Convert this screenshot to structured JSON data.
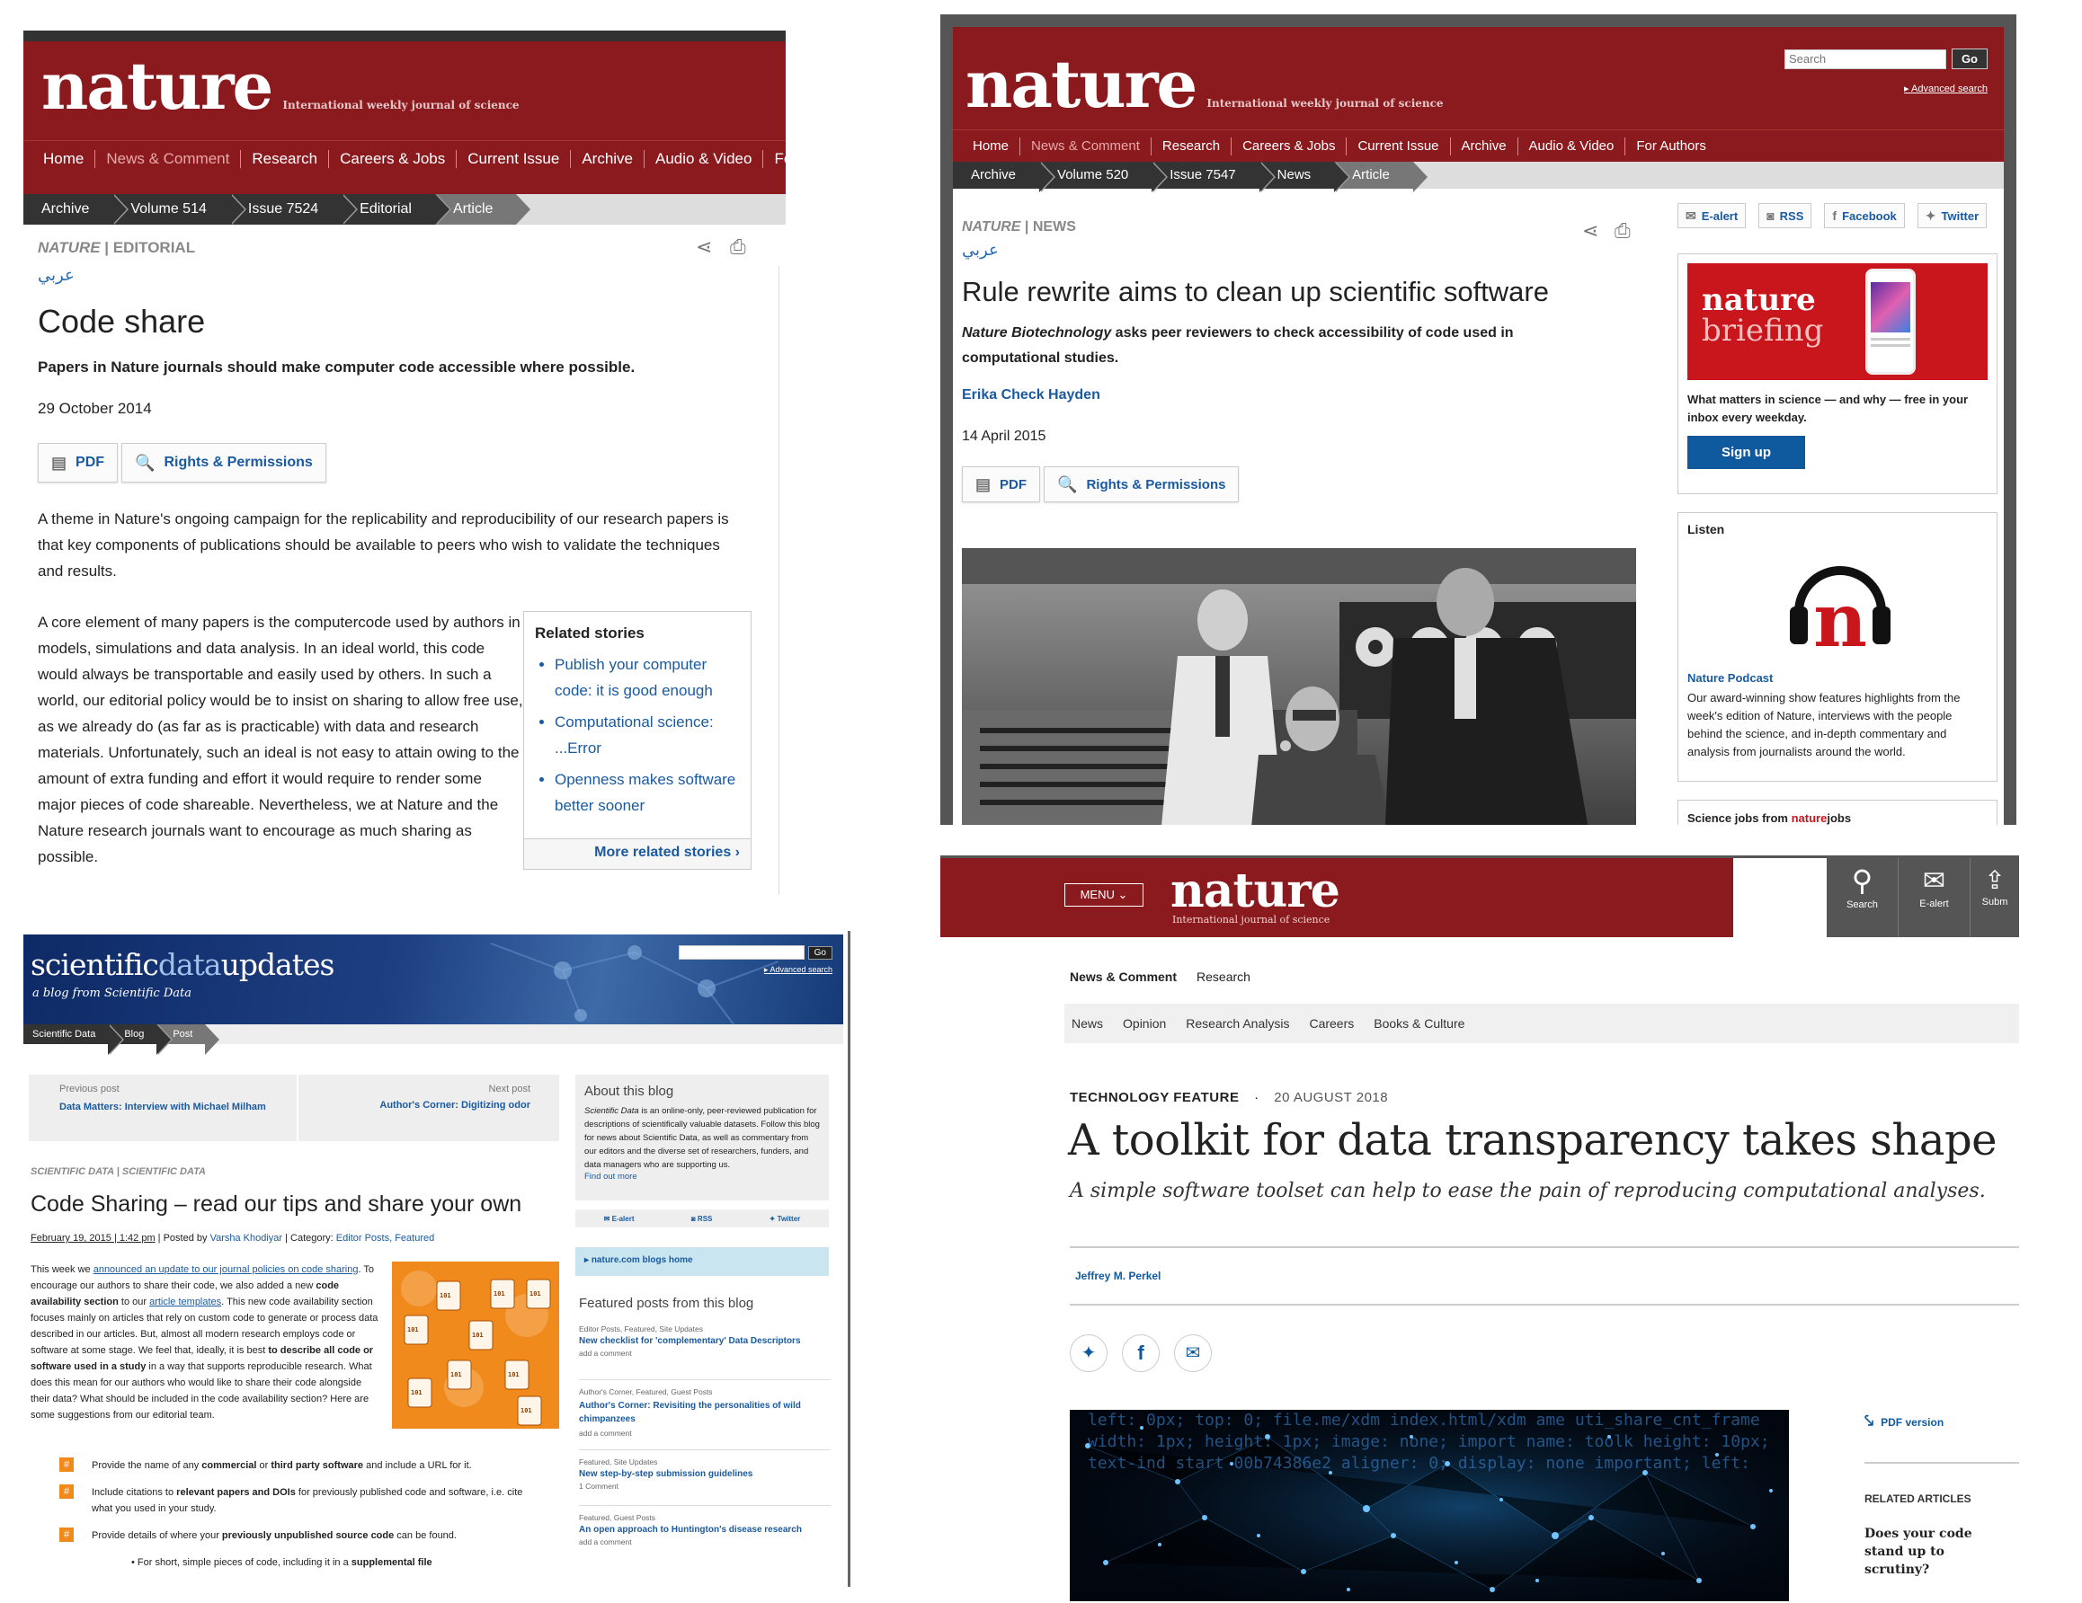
{
  "p1": {
    "logo": "nature",
    "tagline": "International weekly journal of science",
    "nav": [
      "Home",
      "News & Comment",
      "Research",
      "Careers & Jobs",
      "Current Issue",
      "Archive",
      "Audio & Video",
      "For Auth"
    ],
    "crumbs": [
      "Archive",
      "Volume 514",
      "Issue 7524",
      "Editorial",
      "Article"
    ],
    "kicker_a": "NATURE",
    "kicker_sep": " | ",
    "kicker_b": "EDITORIAL",
    "arabic": "عربي",
    "title": "Code share",
    "standfirst": "Papers in Nature journals should make computer code accessible where possible.",
    "date": "29 October 2014",
    "pdf": "PDF",
    "rights": "Rights & Permissions",
    "para1": "A theme in Nature's ongoing campaign for the replicability and reproducibility of our research papers is that key components of publications should be available to peers who wish to validate the techniques and results.",
    "para2": "A core element of many papers is the computercode used by authors in models, simulations and data analysis. In an ideal world, this code would always be transportable and easily used by others. In such a world, our editorial policy would be to insist on sharing to allow free use, as we already do (as far as is practicable) with data and research materials. Unfortunately, such an ideal is not easy to attain owing to the amount of extra funding and effort it would require to render some major pieces of code shareable. Nevertheless, we at Nature and the Nature research journals want to encourage as much sharing as possible.",
    "related_title": "Related stories",
    "related": [
      "Publish your computer code: it is good enough",
      "Computational science: ...Error",
      "Openness makes software better sooner"
    ],
    "more_related": "More related stories"
  },
  "p2": {
    "logo": "nature",
    "tagline": "International weekly journal of science",
    "search_placeholder": "Search",
    "go": "Go",
    "advanced": "Advanced search",
    "nav": [
      "Home",
      "News & Comment",
      "Research",
      "Careers & Jobs",
      "Current Issue",
      "Archive",
      "Audio & Video",
      "For Authors"
    ],
    "crumbs": [
      "Archive",
      "Volume 520",
      "Issue 7547",
      "News",
      "Article"
    ],
    "kicker_a": "NATURE",
    "kicker_sep": " | ",
    "kicker_b": "NEWS",
    "arabic": "عربي",
    "title": "Rule rewrite aims to clean up scientific software",
    "standfirst_i": "Nature Biotechnology",
    "standfirst": " asks peer reviewers to check accessibility of code used in computational studies.",
    "author": "Erika Check Hayden",
    "date": "14 April 2015",
    "pdf": "PDF",
    "rights": "Rights & Permissions",
    "social": [
      "E-alert",
      "RSS",
      "Facebook",
      "Twitter"
    ],
    "briefing_logo1": "nature",
    "briefing_logo2": "briefing",
    "briefing_text": "What matters in science — and why — free in your inbox every weekday.",
    "signup": "Sign up",
    "listen": "Listen",
    "podcast_title": "Nature Podcast",
    "podcast_text": "Our award-winning show features highlights from the week's edition of Nature, interviews with the people behind the science, and in-depth commentary and analysis from journalists around the world.",
    "jobs_a": "Science jobs from ",
    "jobs_b": "nature",
    "jobs_c": "jobs"
  },
  "p3": {
    "logo_a": "scientific",
    "logo_b": "data",
    "logo_c": "updates",
    "sub": "a blog from Scientific Data",
    "go": "Go",
    "advanced": "Advanced search",
    "crumbs": [
      "Scientific Data",
      "Blog",
      "Post"
    ],
    "prev_label": "Previous post",
    "prev_link": "Data Matters: Interview with Michael Milham",
    "next_label": "Next post",
    "next_link": "Author's Corner: Digitizing odor",
    "kicker": "SCIENTIFIC DATA | SCIENTIFIC DATA",
    "title": "Code Sharing – read our tips and share your own",
    "meta_date": "February 19, 2015 | 1:42 pm",
    "meta_rest": " | Posted by ",
    "author": "Varsha Khodiyar",
    "meta_cat": " | Category: ",
    "cats": "Editor Posts, Featured",
    "p1a": "This week we ",
    "p1link": "announced an update to our journal policies on code sharing",
    "p1b": ". To encourage our authors to share their code, we also added a new ",
    "p1bold": "code availability section",
    "p1c": " to our ",
    "p1link2": "article templates",
    "p1d": ". This new code availability section focuses mainly on articles that rely on custom code to generate or process data described in our articles. But, almost all modern research employs code or software at some stage. We feel that, ideally, it is best ",
    "p1bold2": "to describe all code or software used in a study",
    "p1e": " in a way that supports reproducible research. What does this mean for our authors who would like to share their code alongside their data? What should be included in the code availability section? Here are some suggestions from our editorial team.",
    "bullets": [
      {
        "a": "Provide the name of any ",
        "b": "commercial",
        "c": " or ",
        "d": "third party software",
        "e": " and include a URL for it."
      },
      {
        "a": "Include citations to ",
        "b": "relevant papers and DOIs",
        "c": " for previously published code and software, i.e. cite what you used in your study.",
        "d": "",
        "e": ""
      },
      {
        "a": "Provide details of where your ",
        "b": "previously unpublished source code",
        "c": " can be found.",
        "d": "",
        "e": ""
      }
    ],
    "sub_bullet_a": "For short, simple pieces of code, including it in a ",
    "sub_bullet_b": "supplemental file",
    "about_title": "About this blog",
    "about_text_i": "Scientific Data",
    "about_text": " is an online-only, peer-reviewed publication for descriptions of scientifically valuable datasets. Follow this blog for news about Scientific Data, as well as commentary from our editors and the diverse set of researchers, funders, and data managers who are supporting us.",
    "find_more": "Find out more",
    "social": [
      "E-alert",
      "RSS",
      "Twitter"
    ],
    "blogs_home": "nature.com blogs home",
    "featured_title": "Featured posts from this blog",
    "featured": [
      {
        "cat": "Editor Posts, Featured, Site Updates",
        "title": "New checklist for 'complementary' Data Descriptors",
        "c": "add a comment"
      },
      {
        "cat": "Author's Corner, Featured, Guest Posts",
        "title": "Author's Corner: Revisiting the personalities of wild chimpanzees",
        "c": "add a comment"
      },
      {
        "cat": "Featured, Site Updates",
        "title": "New step-by-step submission guidelines",
        "c": "1 Comment"
      },
      {
        "cat": "Featured, Guest Posts",
        "title": "An open approach to Huntington's disease research",
        "c": "add a comment"
      }
    ],
    "code_tag": "101 011"
  },
  "p4": {
    "menu": "MENU",
    "logo": "nature",
    "tagline": "International journal of science",
    "tools": [
      "Search",
      "E-alert",
      "Subm"
    ],
    "nav1": [
      "News & Comment",
      "Research"
    ],
    "nav2": [
      "News",
      "Opinion",
      "Research Analysis",
      "Careers",
      "Books & Culture"
    ],
    "kicker": "TECHNOLOGY FEATURE",
    "dot": "·",
    "date": "20 AUGUST 2018",
    "title": "A toolkit for data transparency takes shape",
    "standfirst": "A simple software toolset can help to ease the pain of reproducing computational analyses.",
    "author": "Jeffrey M. Perkel",
    "pdf": "PDF version",
    "related_label": "RELATED ARTICLES",
    "related_item": "Does your code stand up to scrutiny?",
    "code_text": "left: 0px; top: 0; file.me/xdm index.html/xdm ame uti_share_cnt_frame width: 1px; height: 1px; image: none; import name: toolk height: 10px; text-ind start 00b74386e2 aligner: 0; display: none important; left:"
  },
  "colors": {
    "nature_red": "#8b1a1e",
    "link": "#1a5aa0",
    "sd_blue": "#1d3b7a",
    "orange": "#f08a1c",
    "signup": "#0f5a9e"
  }
}
